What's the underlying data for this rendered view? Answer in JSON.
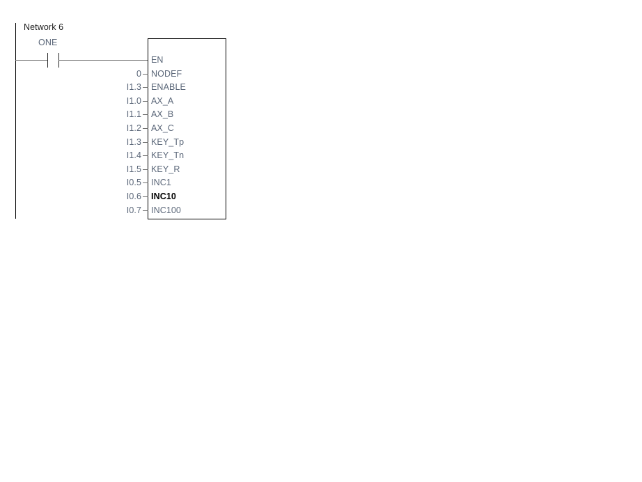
{
  "network": {
    "label": "Network 6"
  },
  "contact": {
    "label": "ONE",
    "type": "normally-open"
  },
  "colors": {
    "text_primary": "#1d1d1d",
    "text_operand": "#5a6678",
    "highlight": "#000000",
    "wire": "#6f6f6f",
    "rail": "#000000",
    "background": "#ffffff"
  },
  "function_block": {
    "parameters": [
      {
        "operand": "",
        "name": "EN",
        "highlight": false,
        "enable_line": true
      },
      {
        "operand": "0",
        "name": "NODEF",
        "highlight": false,
        "enable_line": false
      },
      {
        "operand": "I1.3",
        "name": "ENABLE",
        "highlight": false,
        "enable_line": false
      },
      {
        "operand": "I1.0",
        "name": "AX_A",
        "highlight": false,
        "enable_line": false
      },
      {
        "operand": "I1.1",
        "name": "AX_B",
        "highlight": false,
        "enable_line": false
      },
      {
        "operand": "I1.2",
        "name": "AX_C",
        "highlight": false,
        "enable_line": false
      },
      {
        "operand": "I1.3",
        "name": "KEY_Tp",
        "highlight": false,
        "enable_line": false
      },
      {
        "operand": "I1.4",
        "name": "KEY_Tn",
        "highlight": false,
        "enable_line": false
      },
      {
        "operand": "I1.5",
        "name": "KEY_R",
        "highlight": false,
        "enable_line": false
      },
      {
        "operand": "I0.5",
        "name": "INC1",
        "highlight": false,
        "enable_line": false
      },
      {
        "operand": "I0.6",
        "name": "INC10",
        "highlight": true,
        "enable_line": false
      },
      {
        "operand": "I0.7",
        "name": "INC100",
        "highlight": false,
        "enable_line": false
      }
    ]
  }
}
